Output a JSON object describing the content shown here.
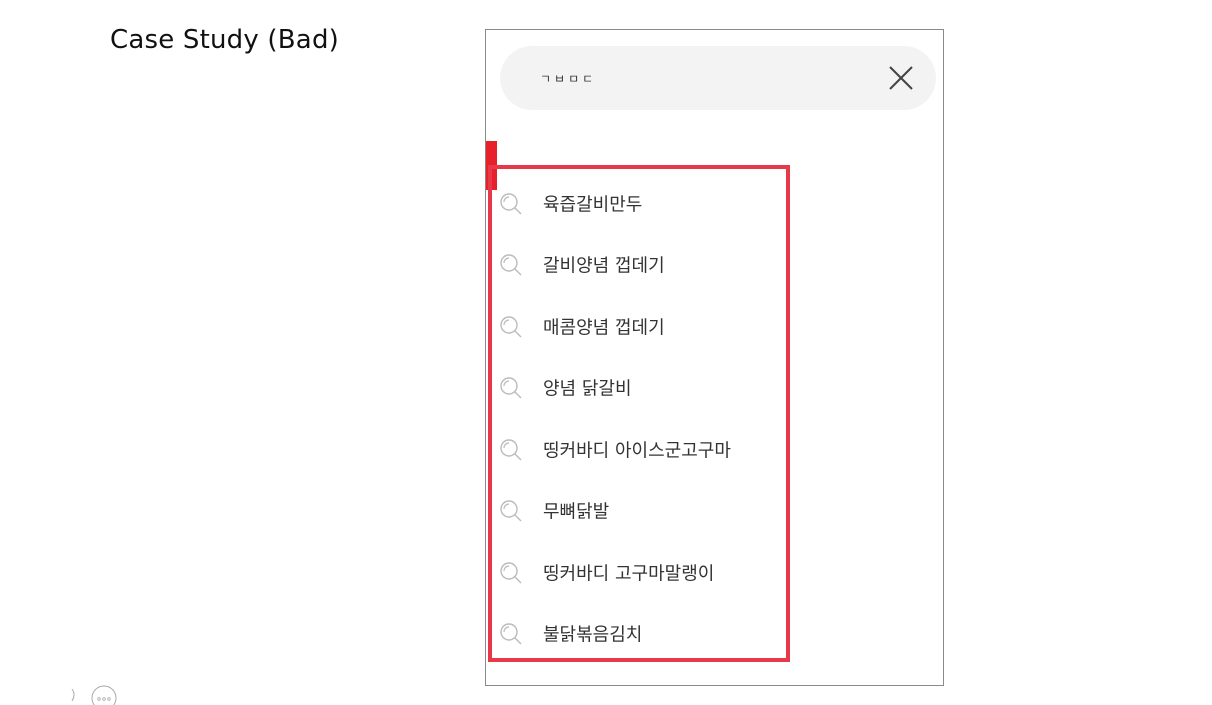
{
  "slide": {
    "title": "Case Study (Bad)"
  },
  "search": {
    "query": "ㄱㅂㅁㄷ",
    "clear_icon": "close-x-icon"
  },
  "suggestions": {
    "icon": "magnifier-icon",
    "items": [
      {
        "label": "육즙갈비만두"
      },
      {
        "label": "갈비양념 껍데기"
      },
      {
        "label": "매콤양념 껍데기"
      },
      {
        "label": "양념 닭갈비"
      },
      {
        "label": "띵커바디 아이스군고구마"
      },
      {
        "label": "무뼈닭발"
      },
      {
        "label": "띵커바디 고구마말랭이"
      },
      {
        "label": "불닭볶음김치"
      }
    ]
  },
  "annotation": {
    "highlight_color": "#e8394a",
    "tab_color": "#e8202a"
  },
  "colors": {
    "search_bar_bg": "#f3f3f3",
    "frame_border": "#8a8a8a",
    "text": "#333333",
    "icon": "#bbbbbb"
  }
}
